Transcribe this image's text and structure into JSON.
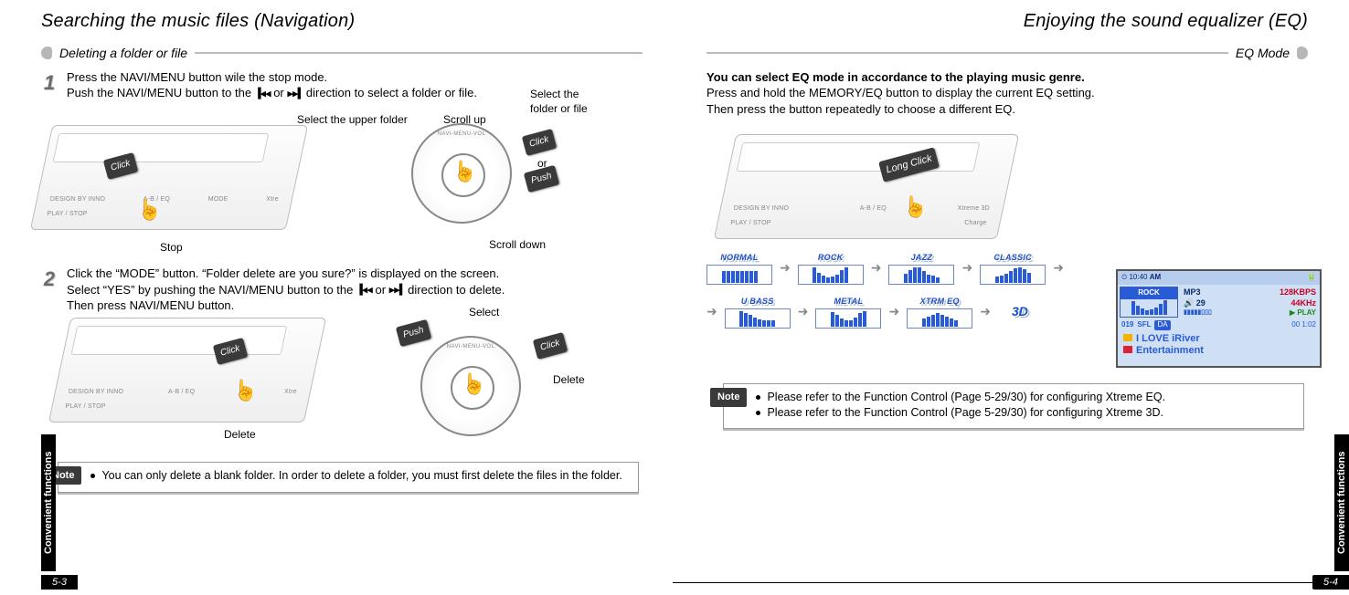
{
  "left": {
    "title": "Searching the music files (Navigation)",
    "subheading": "Deleting a folder or file",
    "step1_num": "1",
    "step1_line1": "Press the NAVI/MENU button wile the stop mode.",
    "step1_line2a": "Push the NAVI/MENU button to the ",
    "step1_line2b": " or ",
    "step1_line2c": " direction to select a folder or file.",
    "device_labels": {
      "a": "DESIGN BY INNO",
      "b": "PLAY / STOP",
      "c": "A-B / EQ",
      "d": "MODE",
      "e": "Xtre"
    },
    "joy_label": "NAVI-MENU-VOL",
    "ann": {
      "stop": "Stop",
      "select_upper": "Select the upper folder",
      "scroll_up": "Scroll up",
      "select_file": "Select the\nfolder or file",
      "scroll_down": "Scroll down",
      "click": "Click",
      "or": "or",
      "push": "Push",
      "select": "Select",
      "delete": "Delete"
    },
    "step2_num": "2",
    "step2_line1": "Click the “MODE” button. “Folder delete are you sure?” is displayed on the screen.",
    "step2_line2a": "Select “YES” by pushing the NAVI/MENU button to the ",
    "step2_line2b": " or ",
    "step2_line2c": " direction to delete.",
    "step2_line3": "Then press NAVI/MENU button.",
    "note_label": "Note",
    "note_text": "You can only delete a blank folder. In order to delete a folder, you must first delete the files in the folder.",
    "side_label": "Convenient functions",
    "page_num": "5-3"
  },
  "right": {
    "title": "Enjoying the sound equalizer (EQ)",
    "subheading": "EQ Mode",
    "intro_bold": "You can select EQ mode in accordance to the playing music genre.",
    "intro_l2": "Press and hold the MEMORY/EQ button to display the current EQ setting.",
    "intro_l3": "Then press the button repeatedly to choose a different EQ.",
    "device_labels": {
      "a": "DESIGN BY INNO",
      "b": "PLAY / STOP",
      "c": "A-B / EQ",
      "d": "Xtreme 3D",
      "e": "Charge"
    },
    "long_click": "Long Click",
    "eq_items": [
      "NORMAL",
      "ROCK",
      "JAZZ",
      "CLASSIC",
      "U BASS",
      "METAL",
      "XTRM EQ",
      "3D"
    ],
    "lcd": {
      "time": "10:40",
      "ampm": "AM",
      "eq_name": "ROCK",
      "format": "MP3",
      "bitrate": "128KBPS",
      "vol": "29",
      "khz": "44KHz",
      "play": "PLAY",
      "track_n": "019",
      "sfl": "SFL",
      "da": "DA",
      "elapsed": "00 1:02",
      "line1": "I LOVE iRiver",
      "line2": "Entertainment"
    },
    "note_label": "Note",
    "note_items": [
      "Please refer to the Function Control (Page 5-29/30) for configuring Xtreme EQ.",
      "Please refer to the Function Control (Page 5-29/30) for configuring Xtreme 3D."
    ],
    "side_label": "Convenient functions",
    "page_num": "5-4"
  },
  "nav_glyphs": {
    "rw": "▐◀◀",
    "ff": "▶▶▌"
  }
}
